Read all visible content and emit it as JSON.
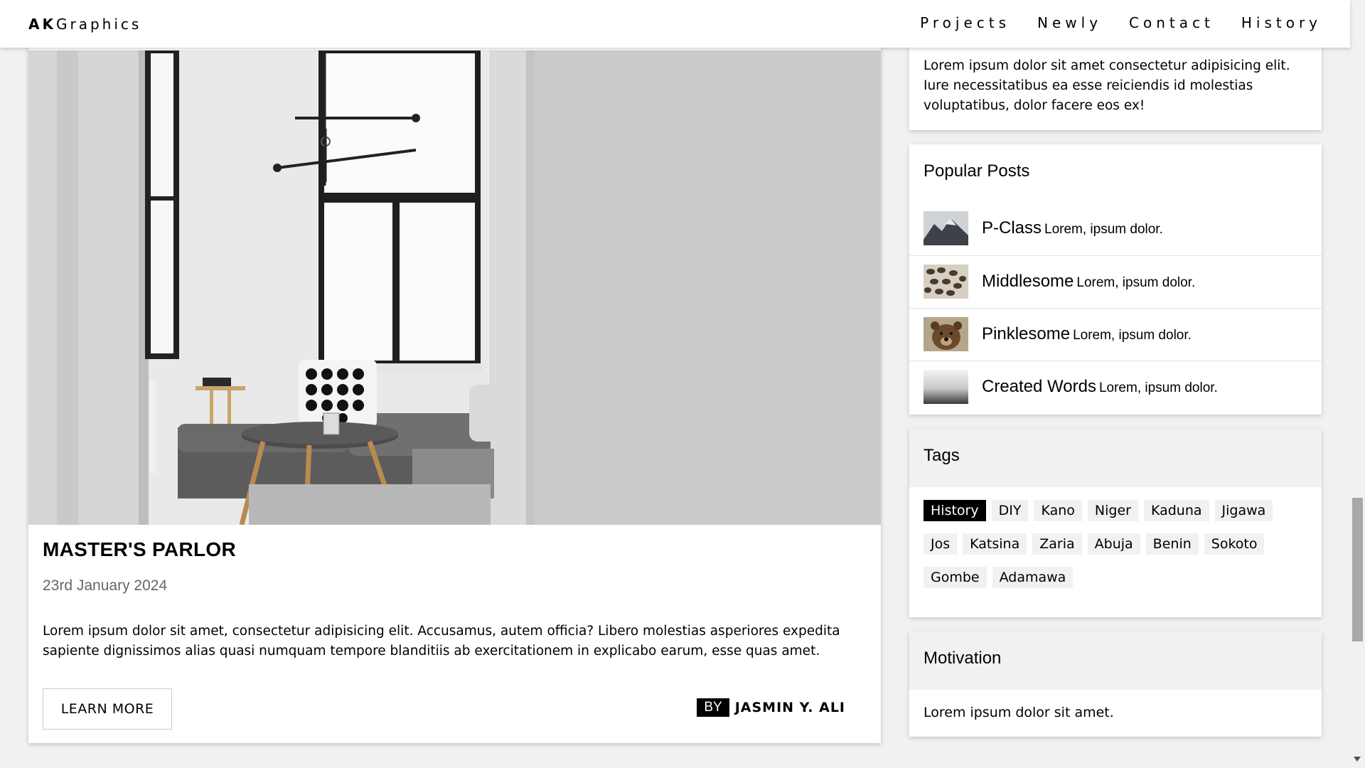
{
  "brand": {
    "strong": "AK",
    "rest": "Graphics"
  },
  "nav": [
    "Projects",
    "Newly",
    "Contact",
    "History"
  ],
  "post": {
    "title": "MASTER'S PARLOR",
    "date": "23rd January 2024",
    "text": "Lorem ipsum dolor sit amet, consectetur adipisicing elit. Accusamus, autem officia? Libero molestias asperiores expedita sapiente dignissimos alias quasi numquam tempore blanditiis ab exercitationem in explicabo earum, esse quas amet.",
    "learn_more": "LEARN MORE",
    "by": "BY",
    "author": "JASMIN Y. ALI"
  },
  "about": {
    "text": "Lorem ipsum dolor sit amet consectetur adipisicing elit. Iure necessitatibus ea esse reiciendis id molestias voluptatibus, dolor facere eos ex!"
  },
  "popular": {
    "heading": "Popular Posts",
    "items": [
      {
        "name": "P-Class",
        "desc": "Lorem, ipsum dolor.",
        "icon": "mountain-thumbnail"
      },
      {
        "name": "Middlesome",
        "desc": "Lorem, ipsum dolor.",
        "icon": "coffee-beans-thumbnail"
      },
      {
        "name": "Pinklesome",
        "desc": "Lorem, ipsum dolor.",
        "icon": "bear-thumbnail"
      },
      {
        "name": "Created Words",
        "desc": "Lorem, ipsum dolor.",
        "icon": "fog-thumbnail"
      }
    ]
  },
  "tags": {
    "heading": "Tags",
    "items": [
      "History",
      "DIY",
      "Kano",
      "Niger",
      "Kaduna",
      "Jigawa",
      "Jos",
      "Katsina",
      "Zaria",
      "Abuja",
      "Benin",
      "Sokoto",
      "Gombe",
      "Adamawa"
    ],
    "active": "History"
  },
  "motivation": {
    "heading": "Motivation",
    "text": "Lorem ipsum dolor sit amet."
  }
}
